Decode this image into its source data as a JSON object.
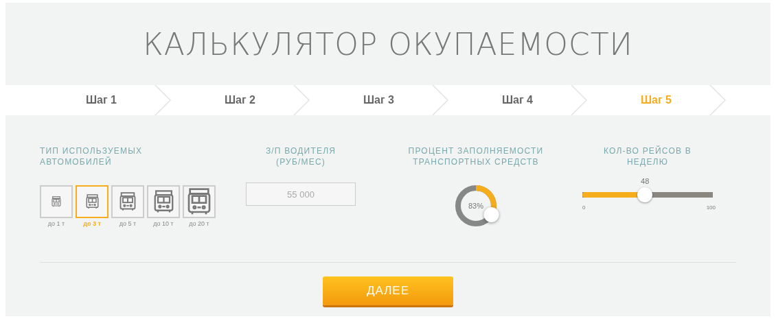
{
  "title": "КАЛЬКУЛЯТОР ОКУПАЕМОСТИ",
  "steps": [
    {
      "label": "Шаг 1",
      "selected": false
    },
    {
      "label": "Шаг 2",
      "selected": false
    },
    {
      "label": "Шаг 3",
      "selected": false
    },
    {
      "label": "Шаг 4",
      "selected": false
    },
    {
      "label": "Шаг 5",
      "selected": true
    }
  ],
  "vehicles": {
    "label": "ТИП ИСПОЛЬЗУЕМЫХ АВТОМОБИЛЕЙ",
    "options": [
      {
        "label": "до 1 т",
        "selected": false
      },
      {
        "label": "до 3 т",
        "selected": true
      },
      {
        "label": "до 5 т",
        "selected": false
      },
      {
        "label": "до 10 т",
        "selected": false
      },
      {
        "label": "до 20 т",
        "selected": false
      }
    ]
  },
  "salary": {
    "label": "З/П ВОДИТЕЛЯ (РУБ/МЕС)",
    "placeholder": "55 000"
  },
  "occupancy": {
    "label": "ПРОЦЕНТ ЗАПОЛНЯЕМОСТИ ТРАНСПОРТНЫХ СРЕДСТВ",
    "reading": "83%"
  },
  "trips": {
    "label": "КОЛ-ВО РЕЙСОВ В НЕДЕЛЮ",
    "reading": "48",
    "level": 0.48,
    "min": "0",
    "max": "100"
  },
  "next_button": "ДАЛЕЕ"
}
